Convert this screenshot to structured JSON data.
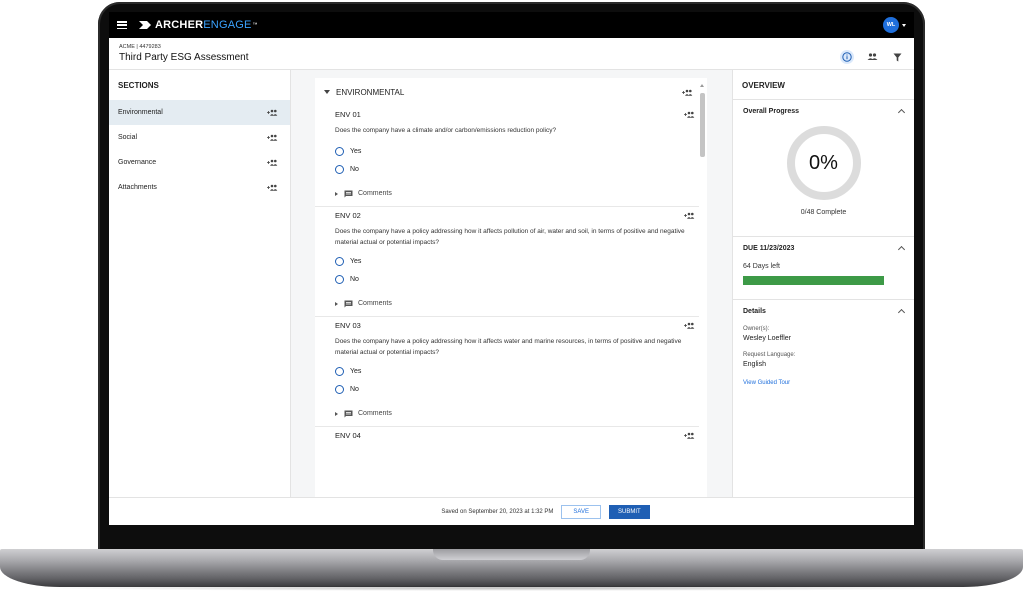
{
  "brand": {
    "part1": "ARCHER",
    "part2": "ENGAGE",
    "tm": "™"
  },
  "user": {
    "initials": "WL"
  },
  "page": {
    "breadcrumb": "ACME | 4479283",
    "title": "Third Party ESG Assessment"
  },
  "sections": {
    "heading": "SECTIONS",
    "items": [
      {
        "label": "Environmental"
      },
      {
        "label": "Social"
      },
      {
        "label": "Governance"
      },
      {
        "label": "Attachments"
      }
    ]
  },
  "main": {
    "section_title": "ENVIRONMENTAL",
    "questions": [
      {
        "id": "ENV 01",
        "text": "Does the company have a climate and/or carbon/emissions reduction policy?",
        "options": [
          "Yes",
          "No"
        ],
        "comments_label": "Comments"
      },
      {
        "id": "ENV 02",
        "text": "Does the company have a policy addressing how it affects pollution of air, water and soil, in terms of positive and negative material actual or potential impacts?",
        "options": [
          "Yes",
          "No"
        ],
        "comments_label": "Comments"
      },
      {
        "id": "ENV 03",
        "text": "Does the company have a policy addressing how it affects water and marine resources, in terms of positive and negative material actual or potential impacts?",
        "options": [
          "Yes",
          "No"
        ],
        "comments_label": "Comments"
      },
      {
        "id": "ENV 04"
      }
    ]
  },
  "overview": {
    "heading": "OVERVIEW",
    "progress": {
      "title": "Overall Progress",
      "percent_label": "0%",
      "percent": 0,
      "count_label": "0/48 Complete"
    },
    "due": {
      "title": "DUE 11/23/2023",
      "days_left": "64 Days left",
      "bar_fill": 1.0,
      "bar_color": "#3d9a47"
    },
    "details": {
      "title": "Details",
      "owner_label": "Owner(s):",
      "owner_value": "Wesley Loeffler",
      "language_label": "Request Language:",
      "language_value": "English",
      "tour_link": "View Guided Tour"
    }
  },
  "footer": {
    "saved_text": "Saved on September 20, 2023 at 1:32 PM",
    "save_label": "SAVE",
    "submit_label": "SUBMIT"
  },
  "icons": {
    "assign": "assign-user-icon",
    "info": "info-icon",
    "people": "people-icon",
    "filter": "filter-icon",
    "comment": "comment-icon"
  },
  "colors": {
    "accent": "#1f5fb4",
    "link": "#1f6fdc",
    "active_section_bg": "#e4ecf2"
  }
}
